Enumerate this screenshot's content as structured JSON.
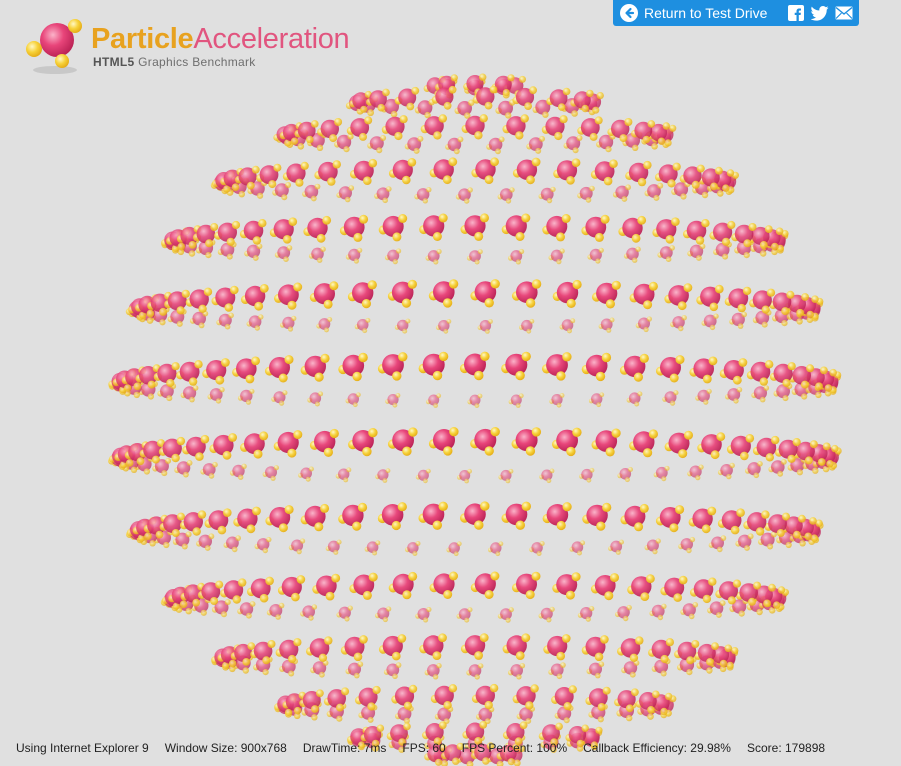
{
  "logo": {
    "title_word1": "Particle",
    "title_word2": "Acceleration",
    "subtitle_bold": "HTML5",
    "subtitle_rest": "Graphics Benchmark"
  },
  "topbar": {
    "back_label": "Return to Test Drive",
    "icons": [
      "back-arrow-icon",
      "facebook-icon",
      "twitter-icon",
      "email-icon"
    ]
  },
  "status": {
    "browser": "Using Internet Explorer 9",
    "window_size": "Window Size: 900x768",
    "draw_time": "DrawTime: 7ms",
    "fps": "FPS: 60",
    "fps_percent": "FPS Percent: 100%",
    "callback_efficiency": "Callback Efficiency: 29.98%",
    "score": "Score: 179898"
  },
  "colors": {
    "background": "#e0e0e0",
    "accent_blue": "#1e8fe0",
    "particle_pink": "#e8457a",
    "particle_yellow": "#f7d23a",
    "title_orange": "#e8a21f",
    "title_pink": "#e1557f"
  }
}
